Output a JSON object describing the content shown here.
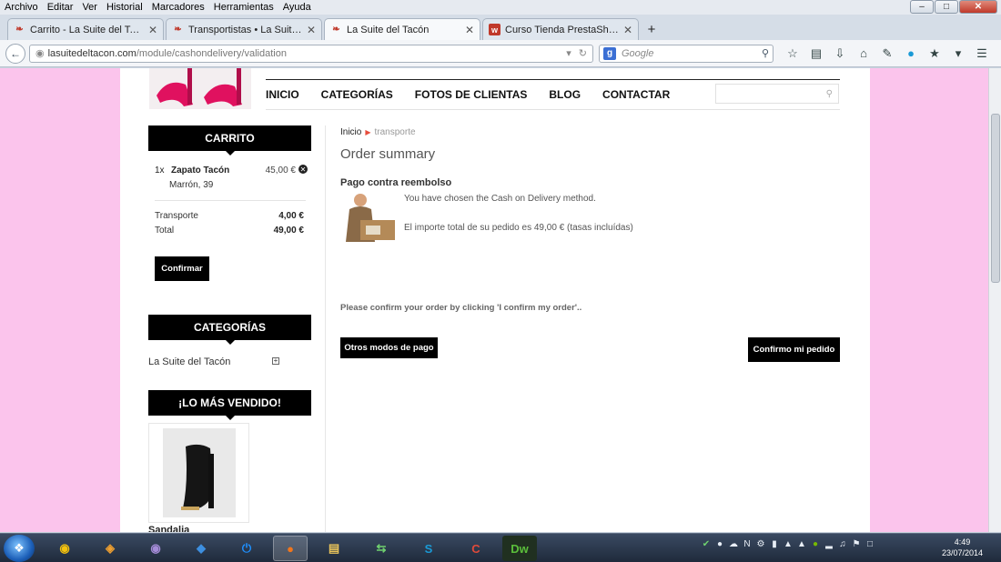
{
  "menubar": [
    "Archivo",
    "Editar",
    "Ver",
    "Historial",
    "Marcadores",
    "Herramientas",
    "Ayuda"
  ],
  "tabs": [
    {
      "title": "Carrito - La Suite del Tacón",
      "icon": "shoe-icon",
      "active": false
    },
    {
      "title": "Transportistas • La Suite de...",
      "icon": "shoe-icon",
      "active": false
    },
    {
      "title": "La Suite del Tacón",
      "icon": "shoe-icon",
      "active": true
    },
    {
      "title": "Curso Tienda PrestaShop: ...",
      "icon": "w-icon",
      "active": false
    }
  ],
  "urlbar": {
    "host": "lasuitedeltacon.com",
    "path": "/module/cashondelivery/validation"
  },
  "websearch": {
    "placeholder": "Google",
    "engine": "g"
  },
  "shop": {
    "nav": [
      "INICIO",
      "CATEGORÍAS",
      "FOTOS DE CLIENTAS",
      "BLOG",
      "CONTACTAR"
    ],
    "cart": {
      "title": "CARRITO",
      "qty": "1x",
      "name": "Zapato Tacón",
      "price": "45,00 €",
      "attr": "Marrón, 39",
      "shipping_label": "Transporte",
      "shipping": "4,00 €",
      "total_label": "Total",
      "total": "49,00 €",
      "confirm": "Confirmar"
    },
    "categories": {
      "title": "CATEGORÍAS",
      "item": "La Suite del Tacón"
    },
    "bestsellers": {
      "title": "¡LO MÁS VENDIDO!",
      "product": "Sandalia"
    },
    "breadcrumb": {
      "home": "Inicio",
      "current": "transporte"
    },
    "summary": {
      "title": "Order summary",
      "method_title": "Pago contra reembolso",
      "msg1": "You have chosen the Cash on Delivery method.",
      "msg2": "El importe total de su pedido es 49,00 € (tasas incluídas)",
      "confirm_text": "Please confirm your order by clicking 'I confirm my order'..",
      "other_methods": "Otros modos de pago",
      "confirm_order": "Confirmo mi pedido"
    }
  },
  "taskbar": {
    "apps": [
      "chrome-icon",
      "paint-icon",
      "orb-icon",
      "dropbox-icon",
      "power-icon",
      "firefox-icon",
      "explorer-icon",
      "sync-icon",
      "skype-icon",
      "ccleaner-icon",
      "dreamweaver-icon"
    ],
    "time": "4:49",
    "date": "23/07/2014"
  },
  "colors": {
    "page_bg": "#fbc4ec",
    "black": "#000000",
    "accent": "#e74c3c"
  }
}
